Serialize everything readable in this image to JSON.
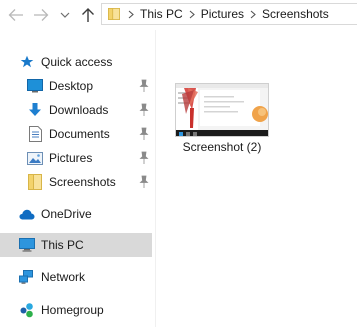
{
  "toolbar": {
    "back_icon": "arrow-left-icon",
    "forward_icon": "arrow-right-icon",
    "recent_icon": "chevron-down-icon",
    "up_icon": "arrow-up-icon"
  },
  "address_bar": {
    "breadcrumbs": [
      "This PC",
      "Pictures",
      "Screenshots"
    ]
  },
  "nav_pane": {
    "quick_access": "Quick access",
    "desktop": "Desktop",
    "downloads": "Downloads",
    "documents": "Documents",
    "pictures": "Pictures",
    "screenshots": "Screenshots",
    "onedrive": "OneDrive",
    "this_pc": "This PC",
    "network": "Network",
    "homegroup": "Homegroup"
  },
  "content": {
    "files": [
      {
        "name": "Screenshot (2)"
      }
    ]
  },
  "colors": {
    "accent": "#1979ca",
    "selected_bg": "#d9d9d9",
    "folder": "#f3d36b"
  }
}
